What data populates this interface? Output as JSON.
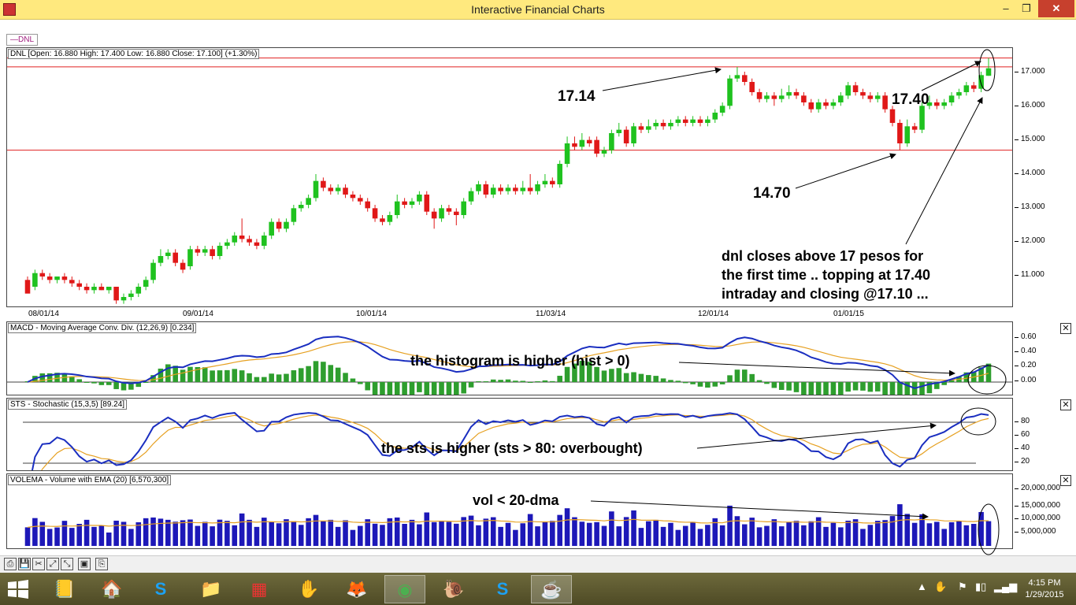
{
  "window": {
    "title": "Interactive Financial Charts",
    "min_label": "–",
    "max_label": "❐",
    "close_label": "✕"
  },
  "legend_chip": "—DNL",
  "price_panel": {
    "label": "DNL [Open: 16.880  High: 17.400  Low: 16.880  Close: 17.100] (+1.30%)",
    "axis": [
      "17.000",
      "16.000",
      "15.000",
      "14.000",
      "13.000",
      "12.000",
      "11.000"
    ],
    "dates": [
      "08/01/14",
      "09/01/14",
      "10/01/14",
      "11/03/14",
      "12/01/14",
      "01/01/15"
    ],
    "annotations": {
      "a1714": "17.14",
      "a1740": "17.40",
      "a1470": "14.70",
      "note1": "dnl closes above 17 pesos for",
      "note2": "the first time .. topping at 17.40",
      "note3": "intraday and closing @17.10 ..."
    }
  },
  "macd_panel": {
    "label": "MACD - Moving Average Conv. Div. (12,26,9) [0.234]",
    "axis": [
      "0.60",
      "0.40",
      "0.20",
      "0.00"
    ],
    "annotation": "the histogram is higher (hist > 0)"
  },
  "sts_panel": {
    "label": "STS - Stochastic (15,3,5) [89.24]",
    "axis": [
      "80",
      "60",
      "40",
      "20"
    ],
    "annotation": "the sts is higher (sts > 80: overbought)"
  },
  "vol_panel": {
    "label": "VOLEMA - Volume with EMA (20) [6,570,300]",
    "axis": [
      "20,000,000",
      "15,000,000",
      "10,000,000",
      "5,000,000"
    ],
    "annotation": "vol < 20-dma"
  },
  "close_box": "✕",
  "toolbar": [
    "⎙",
    "💾",
    "✂",
    "⤢",
    "⤡",
    "▣",
    "⎘"
  ],
  "taskbar": {
    "start_icon": "windows-start-icon",
    "apps": [
      "📒",
      "🏠",
      "S",
      "📁",
      "▦",
      "✋",
      "🦊",
      "◉",
      "🐌",
      "S",
      "☕"
    ],
    "time": "4:15 PM",
    "date": "1/29/2015",
    "tray": [
      "▲",
      "✋",
      "⚑",
      "▮▯",
      "▂▄▆"
    ]
  },
  "chart_data": {
    "type": "candlestick",
    "title": "",
    "xlabel": "",
    "ylabel": "",
    "ylim": [
      10.1,
      17.4
    ],
    "candles": [
      [
        10.9,
        10.5,
        11.0,
        10.6
      ],
      [
        10.7,
        11.1,
        11.2,
        10.6
      ],
      [
        11.1,
        11.0,
        11.2,
        10.9
      ],
      [
        11.0,
        10.9,
        11.1,
        10.8
      ],
      [
        10.9,
        11.0,
        11.0,
        10.8
      ],
      [
        11.0,
        10.9,
        11.1,
        10.8
      ],
      [
        10.9,
        10.8,
        11.0,
        10.7
      ],
      [
        10.8,
        10.7,
        10.9,
        10.6
      ],
      [
        10.7,
        10.6,
        10.8,
        10.5
      ],
      [
        10.6,
        10.7,
        10.8,
        10.5
      ],
      [
        10.7,
        10.6,
        10.8,
        10.6
      ],
      [
        10.6,
        10.7,
        10.7,
        10.5
      ],
      [
        10.7,
        10.3,
        10.7,
        10.2
      ],
      [
        10.3,
        10.4,
        10.5,
        10.2
      ],
      [
        10.4,
        10.5,
        10.6,
        10.3
      ],
      [
        10.5,
        10.7,
        10.8,
        10.4
      ],
      [
        10.7,
        10.9,
        11.0,
        10.6
      ],
      [
        10.9,
        11.4,
        11.5,
        10.8
      ],
      [
        11.4,
        11.6,
        11.8,
        11.3
      ],
      [
        11.6,
        11.7,
        11.8,
        11.5
      ],
      [
        11.7,
        11.4,
        11.8,
        11.3
      ],
      [
        11.4,
        11.2,
        11.5,
        11.1
      ],
      [
        11.3,
        11.8,
        11.9,
        11.2
      ],
      [
        11.8,
        11.7,
        11.9,
        11.6
      ],
      [
        11.7,
        11.8,
        11.9,
        11.6
      ],
      [
        11.8,
        11.6,
        11.9,
        11.5
      ],
      [
        11.6,
        11.9,
        12.0,
        11.5
      ],
      [
        11.9,
        12.0,
        12.1,
        11.8
      ],
      [
        12.0,
        12.2,
        12.3,
        11.9
      ],
      [
        12.2,
        12.1,
        12.7,
        12.0
      ],
      [
        12.1,
        12.0,
        12.2,
        11.9
      ],
      [
        12.0,
        11.9,
        12.1,
        11.8
      ],
      [
        11.9,
        12.2,
        12.3,
        11.8
      ],
      [
        12.2,
        12.6,
        12.7,
        12.1
      ],
      [
        12.6,
        12.4,
        12.7,
        12.3
      ],
      [
        12.4,
        12.6,
        12.7,
        12.3
      ],
      [
        12.6,
        13.0,
        13.1,
        12.5
      ],
      [
        13.0,
        13.1,
        13.2,
        12.9
      ],
      [
        13.1,
        13.3,
        13.4,
        13.0
      ],
      [
        13.3,
        13.8,
        14.0,
        13.2
      ],
      [
        13.8,
        13.6,
        13.9,
        13.5
      ],
      [
        13.6,
        13.5,
        13.7,
        13.4
      ],
      [
        13.5,
        13.6,
        13.7,
        13.4
      ],
      [
        13.6,
        13.4,
        13.7,
        13.3
      ],
      [
        13.4,
        13.3,
        13.5,
        13.2
      ],
      [
        13.3,
        13.2,
        13.4,
        13.1
      ],
      [
        13.2,
        13.0,
        13.3,
        12.9
      ],
      [
        13.0,
        12.7,
        13.1,
        12.6
      ],
      [
        12.7,
        12.6,
        12.8,
        12.5
      ],
      [
        12.6,
        12.8,
        12.9,
        12.5
      ],
      [
        12.8,
        13.2,
        13.4,
        12.7
      ],
      [
        13.2,
        13.1,
        13.3,
        13.0
      ],
      [
        13.1,
        13.2,
        13.3,
        13.0
      ],
      [
        13.2,
        13.4,
        13.5,
        13.1
      ],
      [
        13.4,
        12.9,
        13.5,
        12.8
      ],
      [
        12.9,
        12.7,
        13.0,
        12.4
      ],
      [
        12.7,
        13.0,
        13.1,
        12.6
      ],
      [
        13.0,
        12.9,
        13.1,
        12.8
      ],
      [
        12.9,
        12.8,
        13.0,
        12.5
      ],
      [
        12.8,
        13.2,
        13.3,
        12.7
      ],
      [
        13.2,
        13.5,
        13.6,
        13.1
      ],
      [
        13.5,
        13.7,
        13.8,
        13.4
      ],
      [
        13.7,
        13.4,
        13.8,
        13.3
      ],
      [
        13.4,
        13.6,
        13.7,
        13.3
      ],
      [
        13.6,
        13.5,
        13.7,
        13.4
      ],
      [
        13.5,
        13.6,
        13.7,
        13.4
      ],
      [
        13.6,
        13.5,
        13.7,
        13.4
      ],
      [
        13.5,
        13.6,
        13.8,
        13.4
      ],
      [
        13.6,
        13.5,
        14.0,
        13.4
      ],
      [
        13.5,
        13.7,
        13.8,
        13.4
      ],
      [
        13.7,
        13.8,
        14.0,
        13.6
      ],
      [
        13.8,
        13.7,
        13.9,
        13.6
      ],
      [
        13.7,
        14.3,
        14.4,
        13.6
      ],
      [
        14.3,
        14.9,
        15.1,
        14.2
      ],
      [
        14.9,
        14.8,
        15.1,
        14.7
      ],
      [
        14.8,
        15.0,
        15.2,
        14.7
      ],
      [
        15.0,
        14.9,
        15.1,
        14.8
      ],
      [
        15.0,
        14.6,
        15.1,
        14.5
      ],
      [
        14.6,
        14.7,
        14.8,
        14.5
      ],
      [
        14.7,
        15.2,
        15.3,
        14.6
      ],
      [
        15.2,
        15.3,
        15.5,
        15.1
      ],
      [
        15.3,
        14.9,
        15.4,
        14.8
      ],
      [
        14.9,
        15.4,
        15.5,
        14.8
      ],
      [
        15.4,
        15.3,
        15.5,
        15.2
      ],
      [
        15.3,
        15.4,
        15.6,
        15.2
      ],
      [
        15.4,
        15.5,
        15.6,
        15.3
      ],
      [
        15.5,
        15.4,
        15.6,
        15.3
      ],
      [
        15.4,
        15.5,
        15.6,
        15.3
      ],
      [
        15.5,
        15.6,
        15.7,
        15.4
      ],
      [
        15.6,
        15.5,
        15.7,
        15.4
      ],
      [
        15.5,
        15.6,
        15.7,
        15.4
      ],
      [
        15.6,
        15.5,
        15.7,
        15.4
      ],
      [
        15.5,
        15.6,
        15.7,
        15.4
      ],
      [
        15.6,
        15.8,
        15.9,
        15.5
      ],
      [
        15.8,
        16.0,
        16.1,
        15.7
      ],
      [
        16.0,
        16.8,
        16.9,
        15.9
      ],
      [
        16.8,
        16.9,
        17.14,
        16.7
      ],
      [
        16.9,
        16.7,
        17.0,
        16.6
      ],
      [
        16.7,
        16.4,
        16.8,
        16.3
      ],
      [
        16.4,
        16.2,
        16.5,
        16.1
      ],
      [
        16.2,
        16.3,
        16.4,
        16.1
      ],
      [
        16.3,
        16.2,
        16.4,
        16.0
      ],
      [
        16.2,
        16.3,
        16.5,
        16.1
      ],
      [
        16.3,
        16.4,
        16.6,
        16.2
      ],
      [
        16.4,
        16.3,
        16.5,
        16.2
      ],
      [
        16.3,
        16.1,
        16.4,
        16.0
      ],
      [
        16.1,
        15.9,
        16.2,
        15.8
      ],
      [
        15.9,
        16.1,
        16.2,
        15.8
      ],
      [
        16.1,
        16.0,
        16.2,
        15.9
      ],
      [
        16.0,
        16.1,
        16.2,
        15.9
      ],
      [
        16.1,
        16.3,
        16.4,
        16.0
      ],
      [
        16.3,
        16.6,
        16.7,
        16.2
      ],
      [
        16.6,
        16.4,
        16.7,
        16.3
      ],
      [
        16.4,
        16.3,
        16.5,
        16.2
      ],
      [
        16.3,
        16.2,
        16.4,
        16.1
      ],
      [
        16.2,
        16.3,
        16.4,
        16.1
      ],
      [
        16.3,
        15.9,
        16.4,
        15.8
      ],
      [
        15.9,
        15.5,
        16.0,
        15.4
      ],
      [
        15.5,
        14.9,
        15.6,
        14.7
      ],
      [
        14.9,
        15.4,
        15.6,
        14.8
      ],
      [
        15.4,
        15.3,
        15.5,
        15.2
      ],
      [
        15.3,
        16.0,
        16.1,
        15.2
      ],
      [
        16.0,
        16.1,
        16.3,
        15.9
      ],
      [
        16.1,
        16.0,
        16.2,
        15.9
      ],
      [
        16.0,
        16.1,
        16.2,
        15.9
      ],
      [
        16.1,
        16.3,
        16.4,
        16.0
      ],
      [
        16.3,
        16.4,
        16.5,
        16.2
      ],
      [
        16.4,
        16.6,
        16.7,
        16.3
      ],
      [
        16.6,
        16.5,
        16.7,
        16.4
      ],
      [
        16.5,
        16.9,
        17.0,
        16.4
      ],
      [
        16.88,
        17.1,
        17.4,
        16.88
      ]
    ],
    "reference_lines": [
      17.4,
      17.14,
      14.7
    ],
    "macd": {
      "line_end": 0.234
    },
    "stochastic": {
      "k_end": 89.24
    },
    "volume": {
      "ema_end": 6570300
    }
  }
}
